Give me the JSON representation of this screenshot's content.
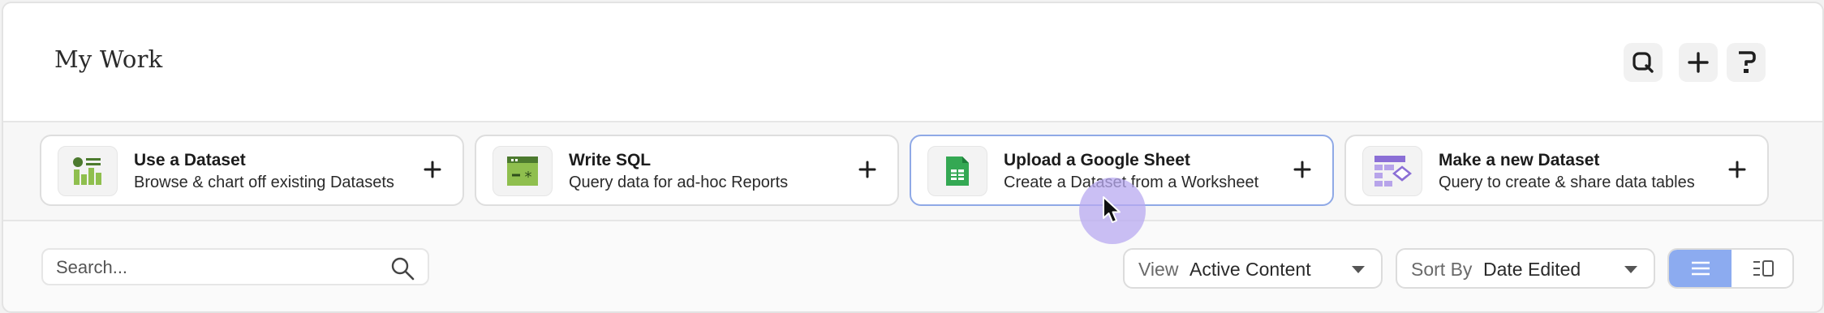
{
  "header": {
    "title": "My Work"
  },
  "header_actions": [
    {
      "name": "search",
      "icon": "search-icon"
    },
    {
      "name": "create",
      "icon": "plus-icon"
    },
    {
      "name": "help",
      "icon": "help-icon"
    }
  ],
  "cards": [
    {
      "title": "Use a Dataset",
      "subtitle": "Browse & chart off existing Datasets",
      "icon": "dataset-chart-icon"
    },
    {
      "title": "Write SQL",
      "subtitle": "Query data for ad-hoc Reports",
      "icon": "sql-terminal-icon"
    },
    {
      "title": "Upload a Google Sheet",
      "subtitle": "Create a Dataset from a Worksheet",
      "icon": "google-sheets-icon"
    },
    {
      "title": "Make a new Dataset",
      "subtitle": "Query to create & share data tables",
      "icon": "new-dataset-icon"
    }
  ],
  "search": {
    "placeholder": "Search..."
  },
  "view_filter": {
    "label": "View",
    "value": "Active Content"
  },
  "sort_filter": {
    "label": "Sort By",
    "value": "Date Edited"
  },
  "layout_toggle": {
    "selected": "list",
    "options": [
      "list-icon",
      "grid-detail-icon"
    ]
  },
  "colors": {
    "accent": "#8cabf0",
    "active_card_border": "#8fa9e6",
    "sheets_green": "#34a853",
    "dataset_green": "#6d9c3a",
    "purple": "#8b6fd6",
    "cursor_halo": "#b8aaf0"
  }
}
